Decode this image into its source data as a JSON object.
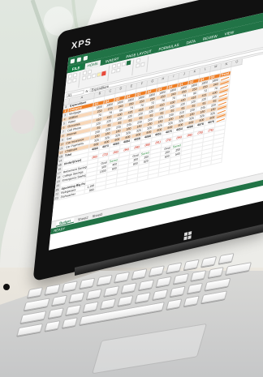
{
  "device": {
    "brand": "XPS"
  },
  "excel": {
    "title_icons": [
      "save-icon",
      "undo-icon",
      "redo-icon"
    ],
    "tabs": [
      "FILE",
      "HOME",
      "INSERT",
      "PAGE LAYOUT",
      "FORMULAS",
      "DATA",
      "REVIEW",
      "VIEW"
    ],
    "name_box": "A1",
    "formula_value": "Expenditure",
    "sheet_tabs": [
      "Budget",
      "Sheet2",
      "Sheet3"
    ],
    "status": "READY",
    "columns": [
      "A",
      "B",
      "C",
      "D",
      "E",
      "F",
      "G",
      "H",
      "I",
      "J",
      "K",
      "L",
      "M",
      "N",
      "O"
    ],
    "rows": [
      [
        "1",
        "Expenditure",
        "",
        "",
        "",
        "",
        "",
        "",
        "",
        "",
        "",
        "",
        "",
        "",
        ""
      ],
      [
        "2",
        "Category",
        "Q1",
        "Q2",
        "Q3",
        "Q4",
        "Q1",
        "Q2",
        "Q3",
        "Q4",
        "Q1",
        "Q2",
        "Q3",
        "Q4",
        "Trend"
      ],
      [
        "3",
        "Mortgage",
        "1800",
        "1800",
        "1800",
        "1800",
        "1800",
        "1800",
        "1800",
        "1800",
        "1800",
        "1800",
        "1800",
        "1800",
        ""
      ],
      [
        "4",
        "Utilities",
        "250",
        "270",
        "240",
        "260",
        "250",
        "280",
        "250",
        "240",
        "260",
        "250",
        "250",
        "240",
        ""
      ],
      [
        "5",
        "Water",
        "70",
        "78",
        "68",
        "74",
        "70",
        "72",
        "76",
        "70",
        "74",
        "80",
        "72",
        "76",
        ""
      ],
      [
        "6",
        "Groceries",
        "410",
        "415",
        "430",
        "425",
        "418",
        "416",
        "410",
        "430",
        "420",
        "416",
        "421",
        "430",
        ""
      ],
      [
        "7",
        "Cell Phone",
        "120",
        "120",
        "120",
        "120",
        "120",
        "120",
        "120",
        "120",
        "120",
        "120",
        "120",
        "120",
        ""
      ],
      [
        "8",
        "Internet",
        "65",
        "65",
        "65",
        "65",
        "65",
        "65",
        "65",
        "65",
        "65",
        "65",
        "65",
        "65",
        ""
      ],
      [
        "9",
        "Gas",
        "240",
        "220",
        "235",
        "245",
        "230",
        "220",
        "225",
        "240",
        "210",
        "230",
        "245",
        "220",
        ""
      ],
      [
        "10",
        "Car Insurance",
        "180",
        "180",
        "180",
        "180",
        "180",
        "180",
        "180",
        "180",
        "180",
        "180",
        "180",
        "180",
        ""
      ],
      [
        "11",
        "Car Payments",
        "325",
        "325",
        "325",
        "325",
        "325",
        "325",
        "325",
        "325",
        "325",
        "325",
        "325",
        "325",
        ""
      ],
      [
        "12",
        "Childcare",
        "600",
        "600",
        "600",
        "600",
        "600",
        "600",
        "600",
        "600",
        "600",
        "600",
        "600",
        "600",
        ""
      ],
      [
        "13",
        "Total",
        "4060",
        "4073",
        "4063",
        "4094",
        "4058",
        "4068",
        "4051",
        "4075",
        "4054",
        "4066",
        "4078",
        "4076",
        ""
      ],
      [
        "14",
        "",
        "",
        "",
        "",
        "",
        "",
        "",
        "",
        "",
        "",
        "",
        "",
        "",
        ""
      ],
      [
        "15",
        "Under/(Over)",
        "(60)",
        "(73)",
        "(63)",
        "(94)",
        "(58)",
        "(68)",
        "(51)",
        "(75)",
        "(54)",
        "(66)",
        "(78)",
        "(76)",
        ""
      ],
      [
        "16",
        "",
        "",
        "",
        "",
        "",
        "",
        "",
        "",
        "",
        "",
        "",
        "",
        "",
        ""
      ],
      [
        "17",
        "Retirement Savings",
        "",
        "Goal",
        "Saved",
        "",
        "Goal",
        "Saved",
        "",
        "Goal",
        "Saved",
        "",
        "",
        "",
        ""
      ],
      [
        "18",
        "College Savings",
        "",
        "500",
        "400",
        "",
        "300",
        "350",
        "",
        "250",
        "250",
        "",
        "",
        "",
        ""
      ],
      [
        "19",
        "Emergency Savings",
        "",
        "1000",
        "900",
        "",
        "800",
        "820",
        "",
        "600",
        "540",
        "",
        "",
        "",
        ""
      ],
      [
        "20",
        "",
        "",
        "",
        "",
        "",
        "",
        "",
        "",
        "",
        "",
        "",
        "",
        "",
        ""
      ],
      [
        "21",
        "Upcoming Big Purchases",
        "",
        "",
        "",
        "",
        "",
        "",
        "",
        "",
        "",
        "",
        "",
        "",
        ""
      ],
      [
        "22",
        "Refrigerator",
        "1,199",
        "",
        "",
        "",
        "",
        "",
        "",
        "",
        "",
        "",
        "",
        "",
        ""
      ],
      [
        "23",
        "Dishwasher",
        "899",
        "",
        "",
        "",
        "",
        "",
        "",
        "",
        "",
        "",
        "",
        "",
        ""
      ]
    ]
  }
}
